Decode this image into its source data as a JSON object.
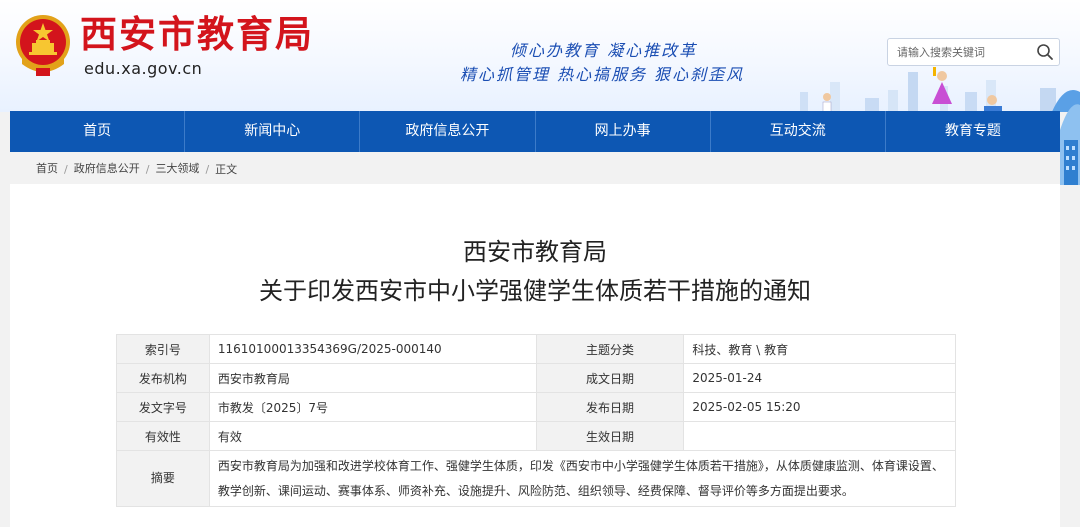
{
  "header": {
    "title": "西安市教育局",
    "domain": "edu.xa.gov.cn",
    "slogan_line1": "倾心办教育  凝心推改革",
    "slogan_line2": "精心抓管理  热心搞服务  狠心刹歪风",
    "search_placeholder": "请输入搜索关键词",
    "emblem_icon": "national-emblem-icon",
    "search_icon": "search-icon"
  },
  "nav": {
    "items": [
      {
        "label": "首页"
      },
      {
        "label": "新闻中心"
      },
      {
        "label": "政府信息公开"
      },
      {
        "label": "网上办事"
      },
      {
        "label": "互动交流"
      },
      {
        "label": "教育专题"
      }
    ]
  },
  "breadcrumb": {
    "items": [
      "首页",
      "政府信息公开",
      "三大领域",
      "正文"
    ],
    "separator": "/"
  },
  "document": {
    "title_line1": "西安市教育局",
    "title_line2": "关于印发西安市中小学强健学生体质若干措施的通知",
    "meta": {
      "index_label": "索引号",
      "index_value": "11610100013354369G/2025-000140",
      "topic_label": "主题分类",
      "topic_value": "科技、教育 \\ 教育",
      "issuer_label": "发布机构",
      "issuer_value": "西安市教育局",
      "written_label": "成文日期",
      "written_value": "2025-01-24",
      "docno_label": "发文字号",
      "docno_value": "市教发〔2025〕7号",
      "published_label": "发布日期",
      "published_value": "2025-02-05 15:20",
      "valid_label": "有效性",
      "valid_value": "有效",
      "effective_label": "生效日期",
      "effective_value": "",
      "abstract_label": "摘要",
      "abstract_value": "西安市教育局为加强和改进学校体育工作、强健学生体质，印发《西安市中小学强健学生体质若干措施》，从体质健康监测、体育课设置、教学创新、课间运动、赛事体系、师资补充、设施提升、风险防范、组织领导、经费保障、督导评价等多方面提出要求。"
    }
  },
  "colors": {
    "brand_red": "#d3141c",
    "nav_blue": "#0d57b3",
    "slogan_blue": "#1b4eb3"
  }
}
